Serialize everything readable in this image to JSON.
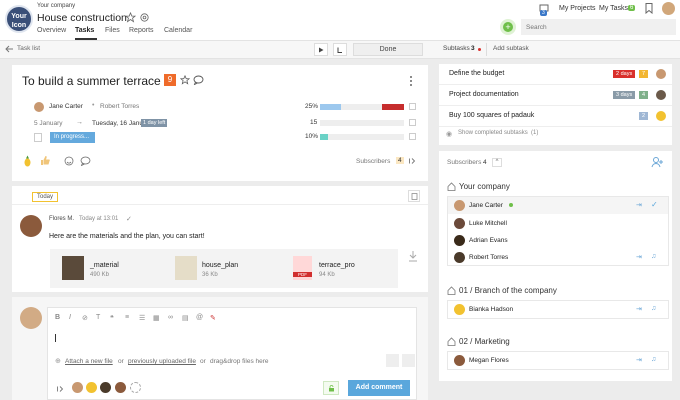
{
  "header": {
    "logo_line1": "Your",
    "logo_line2": "Icon",
    "company": "Your company",
    "project_title": "House construction",
    "tabs": [
      "Overview",
      "Tasks",
      "Files",
      "Reports",
      "Calendar"
    ],
    "my_projects": "My Projects",
    "my_tasks": "My Tasks",
    "my_tasks_badge": "6",
    "notif_badge": "3",
    "search_placeholder": "Search"
  },
  "toolbar": {
    "task_list": "Task list",
    "done": "Done",
    "subtasks_label": "Subtasks",
    "subtasks_count": "3",
    "add_subtask": "Add subtask"
  },
  "task": {
    "title": "To build a summer terrace",
    "badge": "9",
    "assignee": "Jane Carter",
    "reviewer": "Robert Torres",
    "start_date": "5 January",
    "due_date": "Tuesday, 16 January",
    "days_left": "1 day left",
    "status": "In progress...",
    "progress_pct": "25%",
    "progress_value": 0.25,
    "hours": "15",
    "percent2": "10%",
    "percent2_value": 0.1,
    "subscribers_label": "Subscribers",
    "subscribers_count": "4"
  },
  "subtasks": {
    "items": [
      {
        "title": "Define the budget",
        "due": "2 days",
        "due_color": "#d9302c",
        "badge": "7",
        "badge_color": "#f2b632"
      },
      {
        "title": "Project documentation",
        "due": "3 days",
        "due_color": "#8a9ba8",
        "badge": "4",
        "badge_color": "#7fb08a"
      },
      {
        "title": "Buy 100 squares of padauk",
        "due": "",
        "due_color": "",
        "badge": "2",
        "badge_color": "#9fb7d4"
      }
    ],
    "show_completed": "Show completed subtasks",
    "completed_count": "(1)"
  },
  "subscribers": {
    "label": "Subscribers",
    "count": "4",
    "groups": [
      {
        "name": "Your company",
        "members": [
          "Jane Carter",
          "Luke Mitchell",
          "Adrian Evans",
          "Robert Torres"
        ]
      },
      {
        "name": "01 / Branch of the company",
        "members": [
          "Bianka Hadson"
        ]
      },
      {
        "name": "02 / Marketing",
        "members": [
          "Megan Flores"
        ]
      }
    ]
  },
  "comments": {
    "today": "Today",
    "author": "Flores M.",
    "time": "Today at 13:01",
    "text": "Here are the materials and the plan, you can start!",
    "files": [
      {
        "name": "_material",
        "size": "490 Kb"
      },
      {
        "name": "house_plan",
        "size": "36 Kb"
      },
      {
        "name": "terrace_pro",
        "size": "94 Kb",
        "type_label": "PDF"
      }
    ]
  },
  "editor": {
    "attach_new": "Attach a new file",
    "or1": "or",
    "previously": "previously uploaded file",
    "or2": "or",
    "drag": "drag&drop files here",
    "add_comment": "Add comment"
  },
  "colors": {
    "accent_blue": "#5aa7dc",
    "orange_badge": "#ef6b2a",
    "red": "#c62d2d",
    "green": "#6fbf4a"
  }
}
